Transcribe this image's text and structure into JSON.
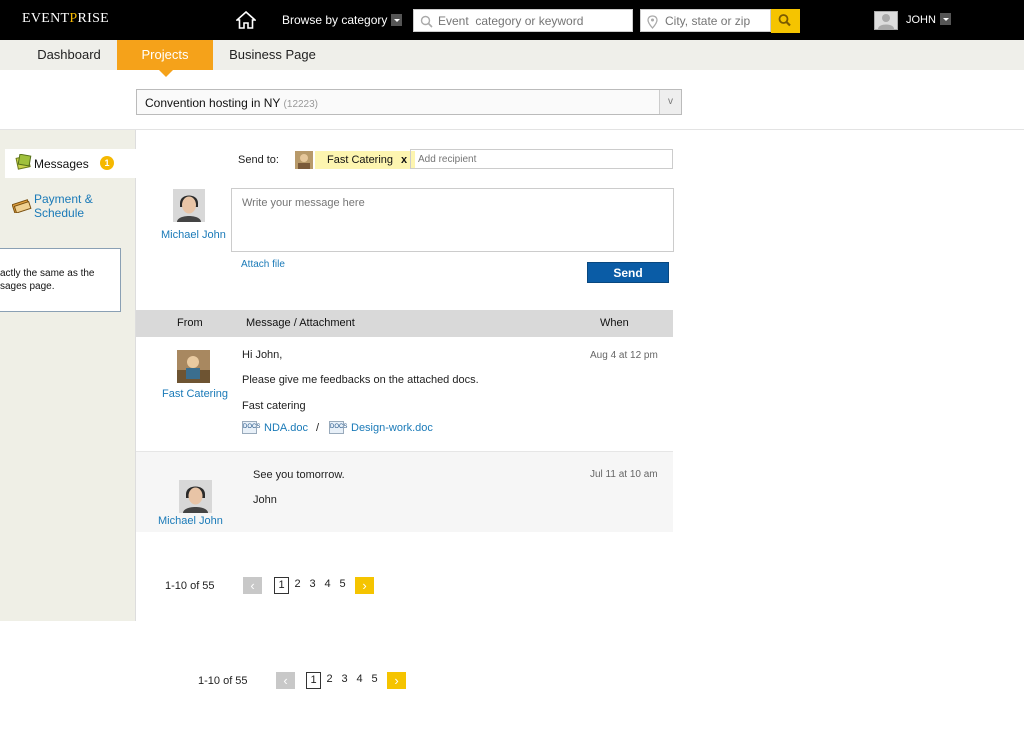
{
  "app": {
    "logo_prefix": "EVENT",
    "logo_p": "P",
    "logo_suffix": "RISE"
  },
  "topbar": {
    "browse_label": "Browse by category",
    "search_placeholder": "Event  category or keyword",
    "location_placeholder": "City, state or zip",
    "user_name": "JOHN"
  },
  "tabs": [
    {
      "label": "Dashboard"
    },
    {
      "label": "Projects"
    },
    {
      "label": "Business Page"
    }
  ],
  "project_select": {
    "name": "Convention hosting in NY",
    "count": "(12223)",
    "dropdown": "v"
  },
  "sidebar": {
    "messages_label": "Messages",
    "messages_badge": "1",
    "payment_label_1": "Payment &",
    "payment_label_2": "Schedule",
    "note_line_1": "xactly the same as the",
    "note_line_2": "ssages page."
  },
  "compose": {
    "send_to_label": "Send to:",
    "recipient_name": "Fast Catering",
    "recipient_remove": "x",
    "add_recipient_placeholder": "Add recipient",
    "sender_name": "Michael John",
    "message_placeholder": "Write your message here",
    "attach_label": "Attach file",
    "send_label": "Send"
  },
  "table": {
    "headers": {
      "from": "From",
      "message": "Message / Attachment",
      "when": "When"
    },
    "rows": [
      {
        "from": "Fast Catering",
        "lines": [
          "Hi John,",
          "Please give me feedbacks on the attached docs.",
          "Fast catering"
        ],
        "attachments": [
          "NDA.doc",
          "Design-work.doc"
        ],
        "separator": "/",
        "doc_icon_text": "DOCS",
        "when": "Aug 4 at 12 pm"
      },
      {
        "from": "Michael John",
        "lines": [
          "See you tomorrow.",
          "John"
        ],
        "when": "Jul 11 at 10 am"
      }
    ]
  },
  "pagination": {
    "count": "1-10 of 55",
    "prev": "‹",
    "next": "›",
    "pages": [
      "1",
      "2",
      "3",
      "4",
      "5"
    ]
  },
  "colors": {
    "accent": "#f5a21a",
    "link": "#1a7ab8",
    "send": "#0a5ca6",
    "yellow": "#f5c400"
  }
}
